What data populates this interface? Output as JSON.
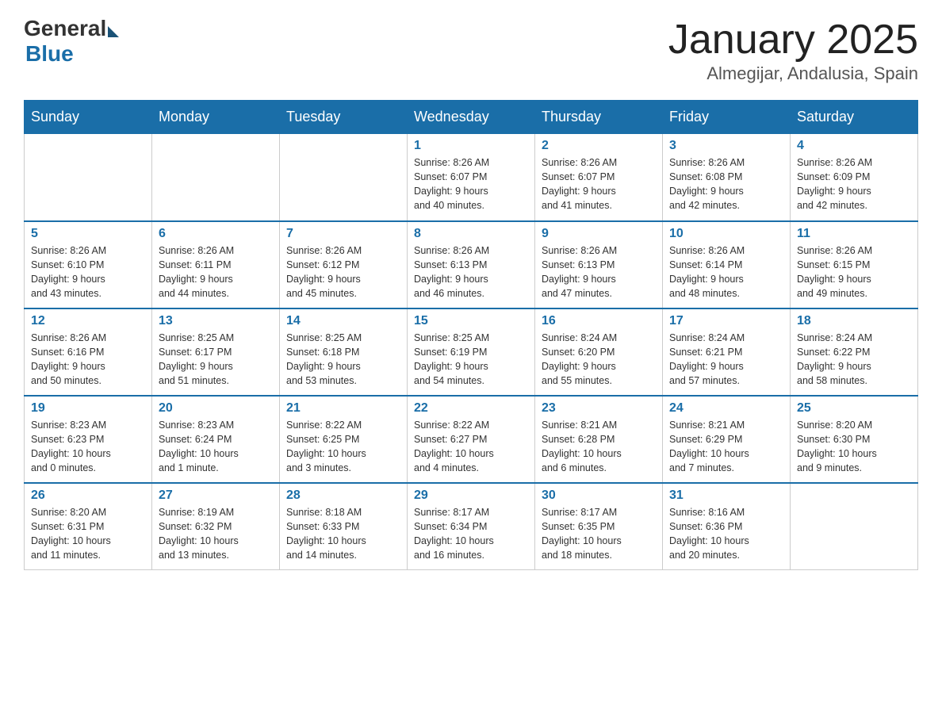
{
  "header": {
    "logo_general": "General",
    "logo_blue": "Blue",
    "month_title": "January 2025",
    "location": "Almegijar, Andalusia, Spain"
  },
  "days_of_week": [
    "Sunday",
    "Monday",
    "Tuesday",
    "Wednesday",
    "Thursday",
    "Friday",
    "Saturday"
  ],
  "weeks": [
    [
      {
        "day": "",
        "info": ""
      },
      {
        "day": "",
        "info": ""
      },
      {
        "day": "",
        "info": ""
      },
      {
        "day": "1",
        "info": "Sunrise: 8:26 AM\nSunset: 6:07 PM\nDaylight: 9 hours\nand 40 minutes."
      },
      {
        "day": "2",
        "info": "Sunrise: 8:26 AM\nSunset: 6:07 PM\nDaylight: 9 hours\nand 41 minutes."
      },
      {
        "day": "3",
        "info": "Sunrise: 8:26 AM\nSunset: 6:08 PM\nDaylight: 9 hours\nand 42 minutes."
      },
      {
        "day": "4",
        "info": "Sunrise: 8:26 AM\nSunset: 6:09 PM\nDaylight: 9 hours\nand 42 minutes."
      }
    ],
    [
      {
        "day": "5",
        "info": "Sunrise: 8:26 AM\nSunset: 6:10 PM\nDaylight: 9 hours\nand 43 minutes."
      },
      {
        "day": "6",
        "info": "Sunrise: 8:26 AM\nSunset: 6:11 PM\nDaylight: 9 hours\nand 44 minutes."
      },
      {
        "day": "7",
        "info": "Sunrise: 8:26 AM\nSunset: 6:12 PM\nDaylight: 9 hours\nand 45 minutes."
      },
      {
        "day": "8",
        "info": "Sunrise: 8:26 AM\nSunset: 6:13 PM\nDaylight: 9 hours\nand 46 minutes."
      },
      {
        "day": "9",
        "info": "Sunrise: 8:26 AM\nSunset: 6:13 PM\nDaylight: 9 hours\nand 47 minutes."
      },
      {
        "day": "10",
        "info": "Sunrise: 8:26 AM\nSunset: 6:14 PM\nDaylight: 9 hours\nand 48 minutes."
      },
      {
        "day": "11",
        "info": "Sunrise: 8:26 AM\nSunset: 6:15 PM\nDaylight: 9 hours\nand 49 minutes."
      }
    ],
    [
      {
        "day": "12",
        "info": "Sunrise: 8:26 AM\nSunset: 6:16 PM\nDaylight: 9 hours\nand 50 minutes."
      },
      {
        "day": "13",
        "info": "Sunrise: 8:25 AM\nSunset: 6:17 PM\nDaylight: 9 hours\nand 51 minutes."
      },
      {
        "day": "14",
        "info": "Sunrise: 8:25 AM\nSunset: 6:18 PM\nDaylight: 9 hours\nand 53 minutes."
      },
      {
        "day": "15",
        "info": "Sunrise: 8:25 AM\nSunset: 6:19 PM\nDaylight: 9 hours\nand 54 minutes."
      },
      {
        "day": "16",
        "info": "Sunrise: 8:24 AM\nSunset: 6:20 PM\nDaylight: 9 hours\nand 55 minutes."
      },
      {
        "day": "17",
        "info": "Sunrise: 8:24 AM\nSunset: 6:21 PM\nDaylight: 9 hours\nand 57 minutes."
      },
      {
        "day": "18",
        "info": "Sunrise: 8:24 AM\nSunset: 6:22 PM\nDaylight: 9 hours\nand 58 minutes."
      }
    ],
    [
      {
        "day": "19",
        "info": "Sunrise: 8:23 AM\nSunset: 6:23 PM\nDaylight: 10 hours\nand 0 minutes."
      },
      {
        "day": "20",
        "info": "Sunrise: 8:23 AM\nSunset: 6:24 PM\nDaylight: 10 hours\nand 1 minute."
      },
      {
        "day": "21",
        "info": "Sunrise: 8:22 AM\nSunset: 6:25 PM\nDaylight: 10 hours\nand 3 minutes."
      },
      {
        "day": "22",
        "info": "Sunrise: 8:22 AM\nSunset: 6:27 PM\nDaylight: 10 hours\nand 4 minutes."
      },
      {
        "day": "23",
        "info": "Sunrise: 8:21 AM\nSunset: 6:28 PM\nDaylight: 10 hours\nand 6 minutes."
      },
      {
        "day": "24",
        "info": "Sunrise: 8:21 AM\nSunset: 6:29 PM\nDaylight: 10 hours\nand 7 minutes."
      },
      {
        "day": "25",
        "info": "Sunrise: 8:20 AM\nSunset: 6:30 PM\nDaylight: 10 hours\nand 9 minutes."
      }
    ],
    [
      {
        "day": "26",
        "info": "Sunrise: 8:20 AM\nSunset: 6:31 PM\nDaylight: 10 hours\nand 11 minutes."
      },
      {
        "day": "27",
        "info": "Sunrise: 8:19 AM\nSunset: 6:32 PM\nDaylight: 10 hours\nand 13 minutes."
      },
      {
        "day": "28",
        "info": "Sunrise: 8:18 AM\nSunset: 6:33 PM\nDaylight: 10 hours\nand 14 minutes."
      },
      {
        "day": "29",
        "info": "Sunrise: 8:17 AM\nSunset: 6:34 PM\nDaylight: 10 hours\nand 16 minutes."
      },
      {
        "day": "30",
        "info": "Sunrise: 8:17 AM\nSunset: 6:35 PM\nDaylight: 10 hours\nand 18 minutes."
      },
      {
        "day": "31",
        "info": "Sunrise: 8:16 AM\nSunset: 6:36 PM\nDaylight: 10 hours\nand 20 minutes."
      },
      {
        "day": "",
        "info": ""
      }
    ]
  ]
}
